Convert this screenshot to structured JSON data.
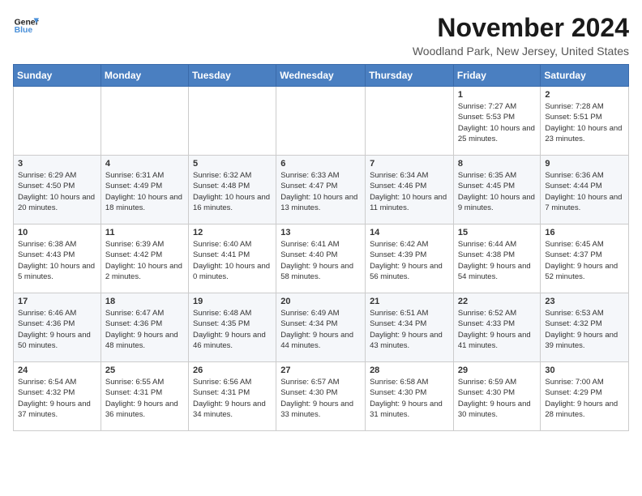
{
  "header": {
    "logo_line1": "General",
    "logo_line2": "Blue",
    "title": "November 2024",
    "subtitle": "Woodland Park, New Jersey, United States"
  },
  "days_of_week": [
    "Sunday",
    "Monday",
    "Tuesday",
    "Wednesday",
    "Thursday",
    "Friday",
    "Saturday"
  ],
  "weeks": [
    [
      {
        "day": "",
        "info": ""
      },
      {
        "day": "",
        "info": ""
      },
      {
        "day": "",
        "info": ""
      },
      {
        "day": "",
        "info": ""
      },
      {
        "day": "",
        "info": ""
      },
      {
        "day": "1",
        "info": "Sunrise: 7:27 AM\nSunset: 5:53 PM\nDaylight: 10 hours and 25 minutes."
      },
      {
        "day": "2",
        "info": "Sunrise: 7:28 AM\nSunset: 5:51 PM\nDaylight: 10 hours and 23 minutes."
      }
    ],
    [
      {
        "day": "3",
        "info": "Sunrise: 6:29 AM\nSunset: 4:50 PM\nDaylight: 10 hours and 20 minutes."
      },
      {
        "day": "4",
        "info": "Sunrise: 6:31 AM\nSunset: 4:49 PM\nDaylight: 10 hours and 18 minutes."
      },
      {
        "day": "5",
        "info": "Sunrise: 6:32 AM\nSunset: 4:48 PM\nDaylight: 10 hours and 16 minutes."
      },
      {
        "day": "6",
        "info": "Sunrise: 6:33 AM\nSunset: 4:47 PM\nDaylight: 10 hours and 13 minutes."
      },
      {
        "day": "7",
        "info": "Sunrise: 6:34 AM\nSunset: 4:46 PM\nDaylight: 10 hours and 11 minutes."
      },
      {
        "day": "8",
        "info": "Sunrise: 6:35 AM\nSunset: 4:45 PM\nDaylight: 10 hours and 9 minutes."
      },
      {
        "day": "9",
        "info": "Sunrise: 6:36 AM\nSunset: 4:44 PM\nDaylight: 10 hours and 7 minutes."
      }
    ],
    [
      {
        "day": "10",
        "info": "Sunrise: 6:38 AM\nSunset: 4:43 PM\nDaylight: 10 hours and 5 minutes."
      },
      {
        "day": "11",
        "info": "Sunrise: 6:39 AM\nSunset: 4:42 PM\nDaylight: 10 hours and 2 minutes."
      },
      {
        "day": "12",
        "info": "Sunrise: 6:40 AM\nSunset: 4:41 PM\nDaylight: 10 hours and 0 minutes."
      },
      {
        "day": "13",
        "info": "Sunrise: 6:41 AM\nSunset: 4:40 PM\nDaylight: 9 hours and 58 minutes."
      },
      {
        "day": "14",
        "info": "Sunrise: 6:42 AM\nSunset: 4:39 PM\nDaylight: 9 hours and 56 minutes."
      },
      {
        "day": "15",
        "info": "Sunrise: 6:44 AM\nSunset: 4:38 PM\nDaylight: 9 hours and 54 minutes."
      },
      {
        "day": "16",
        "info": "Sunrise: 6:45 AM\nSunset: 4:37 PM\nDaylight: 9 hours and 52 minutes."
      }
    ],
    [
      {
        "day": "17",
        "info": "Sunrise: 6:46 AM\nSunset: 4:36 PM\nDaylight: 9 hours and 50 minutes."
      },
      {
        "day": "18",
        "info": "Sunrise: 6:47 AM\nSunset: 4:36 PM\nDaylight: 9 hours and 48 minutes."
      },
      {
        "day": "19",
        "info": "Sunrise: 6:48 AM\nSunset: 4:35 PM\nDaylight: 9 hours and 46 minutes."
      },
      {
        "day": "20",
        "info": "Sunrise: 6:49 AM\nSunset: 4:34 PM\nDaylight: 9 hours and 44 minutes."
      },
      {
        "day": "21",
        "info": "Sunrise: 6:51 AM\nSunset: 4:34 PM\nDaylight: 9 hours and 43 minutes."
      },
      {
        "day": "22",
        "info": "Sunrise: 6:52 AM\nSunset: 4:33 PM\nDaylight: 9 hours and 41 minutes."
      },
      {
        "day": "23",
        "info": "Sunrise: 6:53 AM\nSunset: 4:32 PM\nDaylight: 9 hours and 39 minutes."
      }
    ],
    [
      {
        "day": "24",
        "info": "Sunrise: 6:54 AM\nSunset: 4:32 PM\nDaylight: 9 hours and 37 minutes."
      },
      {
        "day": "25",
        "info": "Sunrise: 6:55 AM\nSunset: 4:31 PM\nDaylight: 9 hours and 36 minutes."
      },
      {
        "day": "26",
        "info": "Sunrise: 6:56 AM\nSunset: 4:31 PM\nDaylight: 9 hours and 34 minutes."
      },
      {
        "day": "27",
        "info": "Sunrise: 6:57 AM\nSunset: 4:30 PM\nDaylight: 9 hours and 33 minutes."
      },
      {
        "day": "28",
        "info": "Sunrise: 6:58 AM\nSunset: 4:30 PM\nDaylight: 9 hours and 31 minutes."
      },
      {
        "day": "29",
        "info": "Sunrise: 6:59 AM\nSunset: 4:30 PM\nDaylight: 9 hours and 30 minutes."
      },
      {
        "day": "30",
        "info": "Sunrise: 7:00 AM\nSunset: 4:29 PM\nDaylight: 9 hours and 28 minutes."
      }
    ]
  ]
}
